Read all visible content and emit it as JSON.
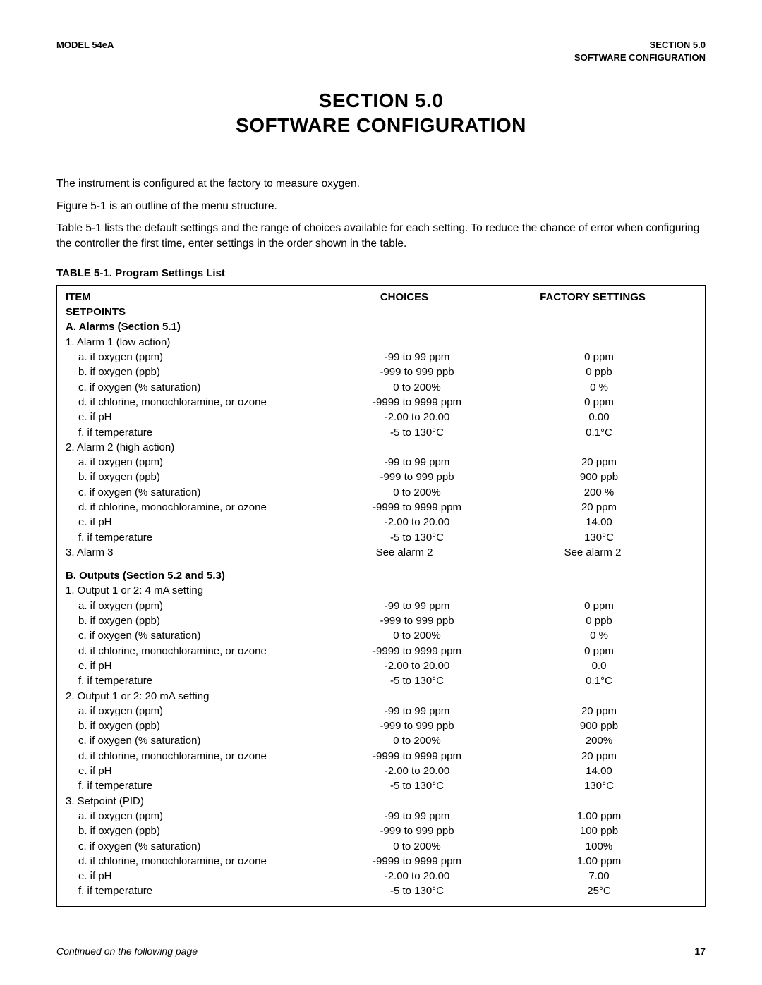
{
  "header": {
    "left": "MODEL 54eA",
    "right1": "SECTION 5.0",
    "right2": "SOFTWARE CONFIGURATION"
  },
  "title1": "SECTION 5.0",
  "title2": "SOFTWARE CONFIGURATION",
  "intro": {
    "p1": "The instrument is configured at the factory to measure oxygen.",
    "p2": "Figure 5-1 is an outline of the menu structure.",
    "p3": "Table 5-1 lists the default settings and the range of choices available for each setting. To reduce the chance of error when configuring the controller the first time, enter settings in the order shown in the table."
  },
  "table": {
    "caption": "TABLE 5-1. Program Settings List",
    "headers": {
      "item": "ITEM",
      "choices": "CHOICES",
      "factory": "FACTORY SETTINGS"
    },
    "setpoints_label": "SETPOINTS",
    "sectionA": {
      "title": "A. Alarms (Section 5.1)",
      "alarm1": {
        "label": "1. Alarm 1 (low action)",
        "a": {
          "item": "a. if oxygen (ppm)",
          "choices": "-99 to 99 ppm",
          "factory": "0 ppm"
        },
        "b": {
          "item": "b. if oxygen (ppb)",
          "choices": "-999 to 999 ppb",
          "factory": "0 ppb"
        },
        "c": {
          "item": "c. if oxygen (% saturation)",
          "choices": "0 to 200%",
          "factory": "0 %"
        },
        "d": {
          "item": "d. if chlorine, monochloramine, or ozone",
          "choices": "-9999 to 9999 ppm",
          "factory": "0 ppm"
        },
        "e": {
          "item": "e. if pH",
          "choices": "-2.00 to 20.00",
          "factory": "0.00"
        },
        "f": {
          "item": "f. if temperature",
          "choices": "-5 to 130°C",
          "factory": "0.1°C"
        }
      },
      "alarm2": {
        "label": "2. Alarm 2 (high action)",
        "a": {
          "item": "a. if oxygen (ppm)",
          "choices": "-99 to 99 ppm",
          "factory": "20 ppm"
        },
        "b": {
          "item": "b. if oxygen (ppb)",
          "choices": "-999 to 999 ppb",
          "factory": "900 ppb"
        },
        "c": {
          "item": "c. if oxygen (% saturation)",
          "choices": "0 to 200%",
          "factory": "200 %"
        },
        "d": {
          "item": "d. if chlorine, monochloramine, or ozone",
          "choices": "-9999 to 9999 ppm",
          "factory": "20 ppm"
        },
        "e": {
          "item": "e. if pH",
          "choices": "-2.00 to 20.00",
          "factory": "14.00"
        },
        "f": {
          "item": "f. if temperature",
          "choices": "-5 to 130°C",
          "factory": "130°C"
        }
      },
      "alarm3": {
        "item": "3. Alarm 3",
        "choices": "See alarm 2",
        "factory": "See alarm 2"
      }
    },
    "sectionB": {
      "title": "B. Outputs (Section 5.2 and 5.3)",
      "out4": {
        "label": "1. Output 1 or 2: 4 mA setting",
        "a": {
          "item": "a. if oxygen (ppm)",
          "choices": "-99 to 99 ppm",
          "factory": "0 ppm"
        },
        "b": {
          "item": "b. if oxygen (ppb)",
          "choices": "-999 to 999 ppb",
          "factory": "0 ppb"
        },
        "c": {
          "item": "c. if oxygen (% saturation)",
          "choices": "0 to 200%",
          "factory": "0 %"
        },
        "d": {
          "item": "d. if chlorine, monochloramine, or ozone",
          "choices": "-9999 to 9999 ppm",
          "factory": "0 ppm"
        },
        "e": {
          "item": "e. if pH",
          "choices": "-2.00 to 20.00",
          "factory": "0.0"
        },
        "f": {
          "item": "f. if temperature",
          "choices": "-5 to 130°C",
          "factory": "0.1°C"
        }
      },
      "out20": {
        "label": "2. Output 1 or 2: 20 mA setting",
        "a": {
          "item": "a. if oxygen (ppm)",
          "choices": "-99 to 99 ppm",
          "factory": "20 ppm"
        },
        "b": {
          "item": "b. if oxygen (ppb)",
          "choices": "-999 to 999 ppb",
          "factory": "900 ppb"
        },
        "c": {
          "item": "c. if oxygen (% saturation)",
          "choices": "0 to 200%",
          "factory": "200%"
        },
        "d": {
          "item": "d. if chlorine, monochloramine, or ozone",
          "choices": "-9999 to 9999 ppm",
          "factory": "20 ppm"
        },
        "e": {
          "item": "e. if pH",
          "choices": "-2.00 to 20.00",
          "factory": "14.00"
        },
        "f": {
          "item": "f. if temperature",
          "choices": "-5 to 130°C",
          "factory": "130°C"
        }
      },
      "pid": {
        "label": "3. Setpoint (PID)",
        "a": {
          "item": "a. if oxygen (ppm)",
          "choices": "-99 to 99 ppm",
          "factory": "1.00 ppm"
        },
        "b": {
          "item": "b. if oxygen (ppb)",
          "choices": "-999 to 999 ppb",
          "factory": "100 ppb"
        },
        "c": {
          "item": "c. if oxygen (% saturation)",
          "choices": "0 to 200%",
          "factory": "100%"
        },
        "d": {
          "item": "d. if chlorine, monochloramine, or ozone",
          "choices": "-9999 to 9999 ppm",
          "factory": "1.00 ppm"
        },
        "e": {
          "item": "e. if pH",
          "choices": "-2.00 to 20.00",
          "factory": "7.00"
        },
        "f": {
          "item": "f. if temperature",
          "choices": "-5 to 130°C",
          "factory": "25°C"
        }
      }
    }
  },
  "footer": {
    "continued": "Continued on the following page",
    "pagenum": "17"
  }
}
